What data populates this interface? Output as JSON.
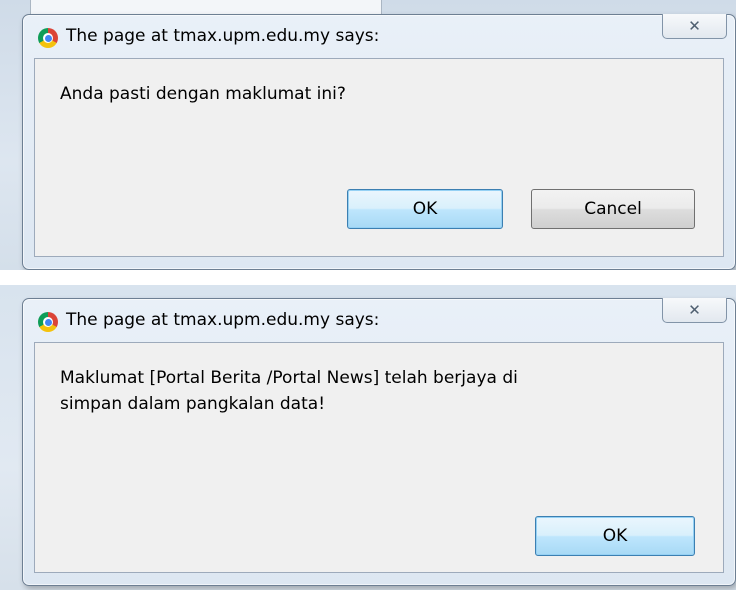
{
  "dialogs": [
    {
      "title": "The page at tmax.upm.edu.my says:",
      "message": "Anda pasti dengan maklumat ini?",
      "ok_label": "OK",
      "cancel_label": "Cancel",
      "close_symbol": "✕"
    },
    {
      "title": "The page at tmax.upm.edu.my says:",
      "message": "Maklumat [Portal Berita /Portal News] telah berjaya di\nsimpan dalam pangkalan data!",
      "ok_label": "OK",
      "close_symbol": "✕"
    }
  ],
  "icons": {
    "app": "chrome-icon",
    "close": "close-icon"
  },
  "colors": {
    "default_button_border": "#3c7fb1",
    "frame": "#dde7f2"
  }
}
